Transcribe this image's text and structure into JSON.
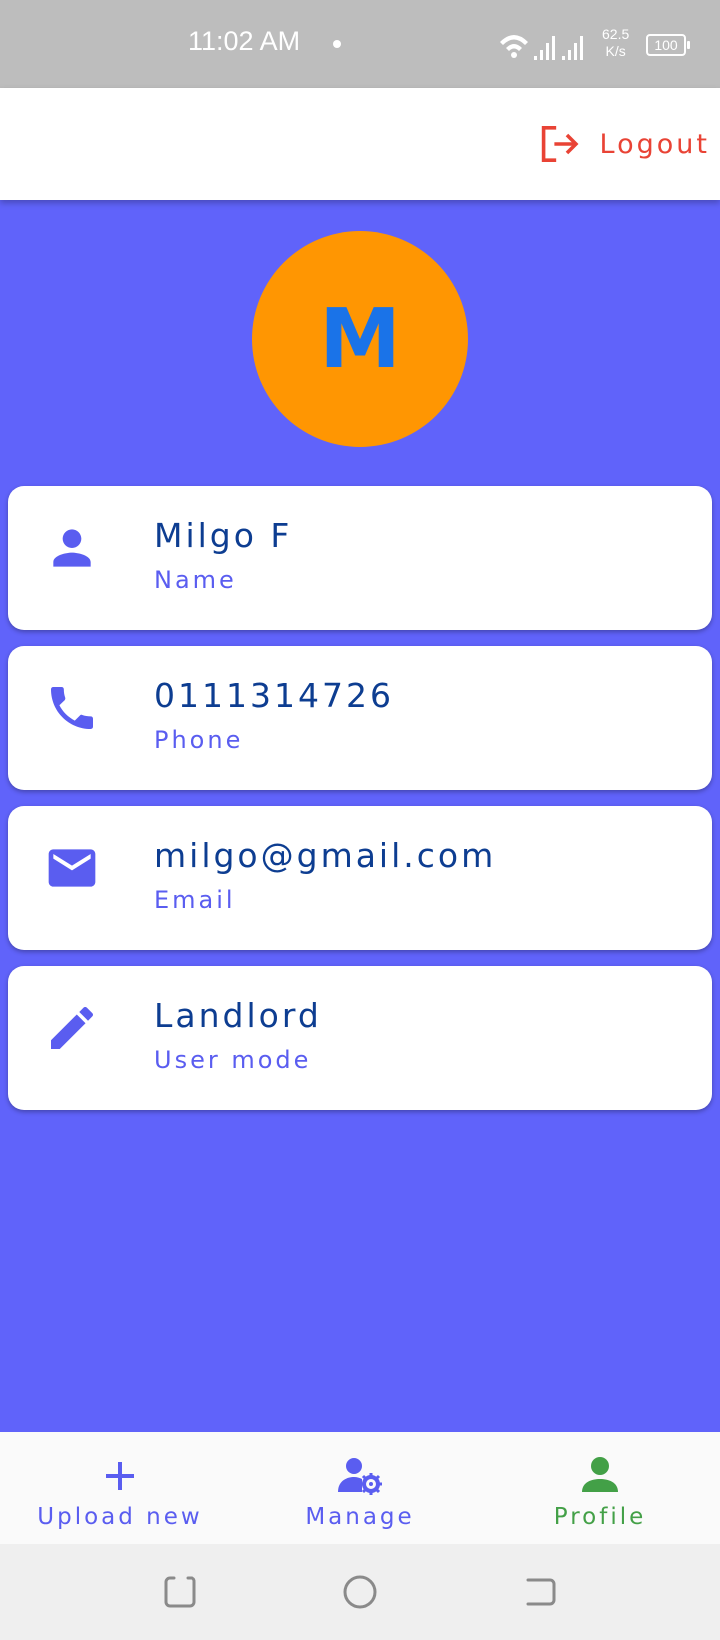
{
  "status_bar": {
    "time": "11:02 AM",
    "net_speed_value": "62.5",
    "net_speed_unit": "K/s",
    "battery": "100"
  },
  "app_bar": {
    "logout_label": "Logout",
    "logout_color": "#e94335"
  },
  "profile": {
    "avatar_letter": "M",
    "avatar_color": "#ff9602",
    "background_color": "#6063fa"
  },
  "fields": [
    {
      "icon": "person-icon",
      "value": "Milgo F",
      "label": "Name"
    },
    {
      "icon": "phone-icon",
      "value": "0111314726",
      "label": "Phone"
    },
    {
      "icon": "email-icon",
      "value": "milgo@gmail.com",
      "label": "Email"
    },
    {
      "icon": "pencil-icon",
      "value": "Landlord",
      "label": "User mode"
    }
  ],
  "bottom_nav": {
    "items": [
      {
        "icon": "plus-icon",
        "label": "Upload new",
        "active": false
      },
      {
        "icon": "person-gear-icon",
        "label": "Manage",
        "active": false
      },
      {
        "icon": "person-icon",
        "label": "Profile",
        "active": true
      }
    ],
    "inactive_color": "#5a5df0",
    "active_color": "#43a047"
  }
}
